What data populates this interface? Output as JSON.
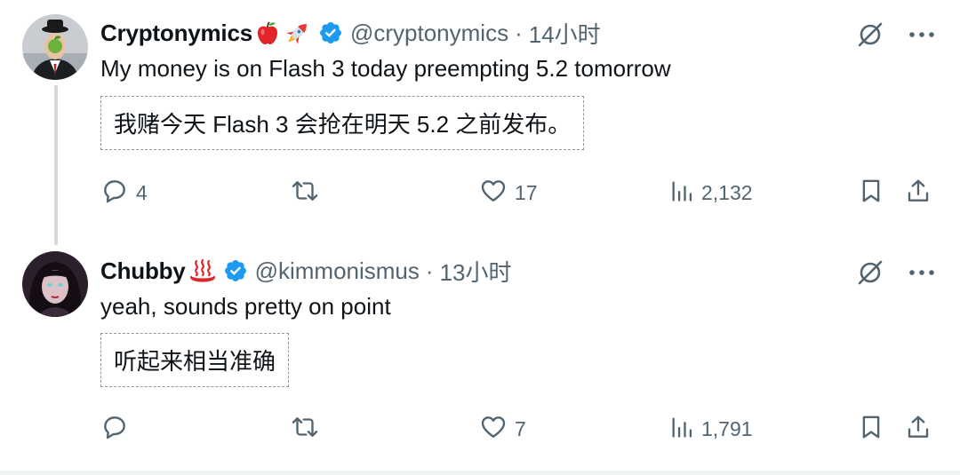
{
  "tweets": [
    {
      "display_name": "Cryptonymics",
      "name_emojis": [
        "red-apple",
        "rocket"
      ],
      "handle": "@cryptonymics",
      "separator": "·",
      "time": "14小时",
      "text": "My money is on Flash 3 today preempting 5.2 tomorrow",
      "translation": "我赌今天 Flash 3 会抢在明天 5.2 之前发布。",
      "replies": "4",
      "retweets": "",
      "likes": "17",
      "views": "2,132",
      "verified": true
    },
    {
      "display_name": "Chubby",
      "name_emojis": [
        "hot-springs"
      ],
      "handle": "@kimmonismus",
      "separator": "·",
      "time": "13小时",
      "text": "yeah, sounds pretty on point",
      "translation": "听起来相当准确",
      "replies": "",
      "retweets": "",
      "likes": "7",
      "views": "1,791",
      "verified": true
    }
  ],
  "icons": {
    "verified": "verified-badge-icon",
    "grok": "grok-icon",
    "more": "more-icon",
    "reply": "reply-icon",
    "retweet": "retweet-icon",
    "like": "heart-icon",
    "views": "views-icon",
    "bookmark": "bookmark-icon",
    "share": "share-icon"
  },
  "colors": {
    "text": "#0f1419",
    "secondary": "#536471",
    "verified": "#1d9bf0",
    "thread_line": "#cfd9de",
    "dashed_border": "#8b98a5"
  }
}
